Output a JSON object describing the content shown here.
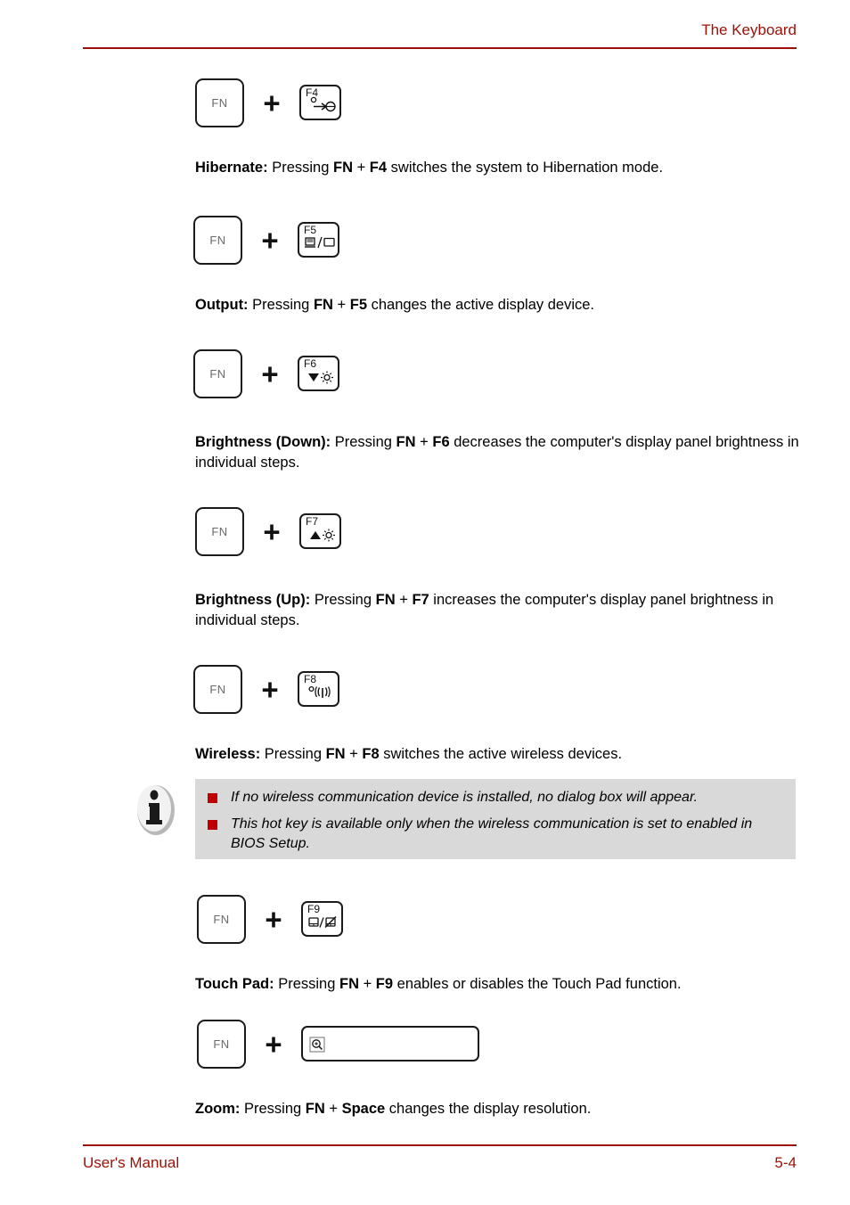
{
  "header": {
    "title": "The Keyboard"
  },
  "footer": {
    "left": "User's Manual",
    "right": "5-4"
  },
  "keys": {
    "fn_label": "FN",
    "plus": "+"
  },
  "colors": {
    "accent_red": "#9c1006",
    "bullet_red": "#c00000",
    "note_bg": "#d9d9d9",
    "key_border": "#1a1a1a",
    "fn_text": "#6a6a6a"
  },
  "sections": [
    {
      "key_label": "F4",
      "key_icon": "hibernate-icon",
      "lead": "Hibernate:",
      "body_1": " Pressing ",
      "mod": "FN",
      "plus": " + ",
      "fkey": "F4",
      "body_2": " switches the system to Hibernation mode."
    },
    {
      "key_label": "F5",
      "key_icon": "display-output-icon",
      "lead": "Output:",
      "body_1": " Pressing ",
      "mod": "FN",
      "plus": " + ",
      "fkey": "F5",
      "body_2": " changes the active display device."
    },
    {
      "key_label": "F6",
      "key_icon": "brightness-down-icon",
      "lead": "Brightness (Down):",
      "body_1": " Pressing ",
      "mod": "FN",
      "plus": " + ",
      "fkey": "F6",
      "body_2": " decreases the computer's display panel brightness in individual steps."
    },
    {
      "key_label": "F7",
      "key_icon": "brightness-up-icon",
      "lead": "Brightness (Up):",
      "body_1": " Pressing ",
      "mod": "FN",
      "plus": " + ",
      "fkey": "F7",
      "body_2": " increases the computer's display panel brightness in individual steps."
    },
    {
      "key_label": "F8",
      "key_icon": "wireless-icon",
      "lead": "Wireless:",
      "body_1": " Pressing ",
      "mod": "FN",
      "plus": " + ",
      "fkey": "F8",
      "body_2": " switches the active wireless devices."
    },
    {
      "key_label": "F9",
      "key_icon": "touchpad-icon",
      "lead": "Touch Pad:",
      "body_1": " Pressing ",
      "mod": "FN",
      "plus": " + ",
      "fkey": "F9",
      "body_2": " enables or disables the Touch Pad function."
    },
    {
      "key_label": "",
      "key_icon": "zoom-icon",
      "lead": "Zoom:",
      "body_1": " Pressing ",
      "mod": "FN",
      "plus": " + ",
      "fkey": "Space",
      "body_2": " changes the display resolution."
    }
  ],
  "note": {
    "icon": "information-icon",
    "items": [
      "If no wireless communication device is installed, no dialog box will appear.",
      "This hot key is available only when the wireless communication is set to enabled in BIOS Setup."
    ]
  }
}
